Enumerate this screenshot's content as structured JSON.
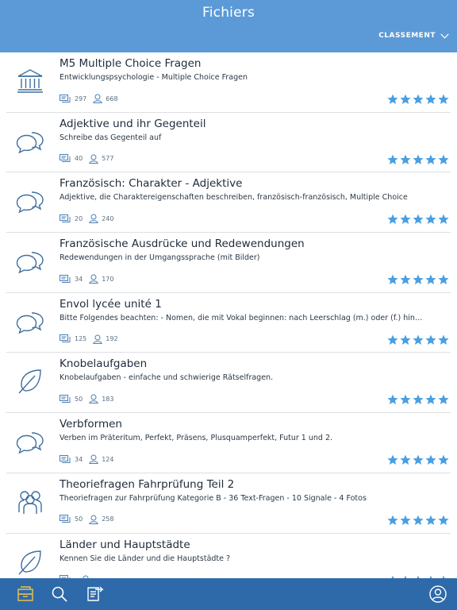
{
  "header": {
    "title": "Fichiers",
    "sort_label": "CLASSEMENT"
  },
  "colors": {
    "header": "#5b9ad6",
    "tabbar": "#2e6aa9",
    "star": "#4a9fe0",
    "tab_active": "#f2c44b"
  },
  "items": [
    {
      "title": "M5 Multiple Choice Fragen",
      "description": "Entwicklungspsychologie - Multiple Choice Fragen",
      "cards": "297",
      "users": "668",
      "icon": "institution-icon",
      "rating": 5
    },
    {
      "title": "Adjektive und ihr Gegenteil",
      "description": "Schreibe das Gegenteil auf",
      "cards": "40",
      "users": "577",
      "icon": "speech-bubbles-icon",
      "rating": 5
    },
    {
      "title": "Französisch: Charakter - Adjektive",
      "description": "Adjektive, die Charaktereigenschaften beschreiben, französisch-französisch, Multiple Choice",
      "cards": "20",
      "users": "240",
      "icon": "speech-bubbles-icon",
      "rating": 5
    },
    {
      "title": "Französische Ausdrücke und Redewendungen",
      "description": "Redewendungen in der Umgangssprache (mit Bilder)",
      "cards": "34",
      "users": "170",
      "icon": "speech-bubbles-icon",
      "rating": 5
    },
    {
      "title": "Envol lycée unité 1",
      "description": "Bitte Folgendes beachten: - Nomen, die mit Vokal beginnen: nach Leerschlag (m.) oder (f.) hinzu…",
      "cards": "125",
      "users": "192",
      "icon": "speech-bubbles-icon",
      "rating": 5
    },
    {
      "title": "Knobelaufgaben",
      "description": "Knobelaufgaben - einfache und schwierige Rätselfragen.",
      "cards": "50",
      "users": "183",
      "icon": "leaf-icon",
      "rating": 5
    },
    {
      "title": "Verbformen",
      "description": "Verben im Präteritum, Perfekt, Präsens, Plusquamperfekt, Futur 1 und 2.",
      "cards": "34",
      "users": "124",
      "icon": "speech-bubbles-icon",
      "rating": 5
    },
    {
      "title": "Theoriefragen Fahrprüfung Teil 2",
      "description": "Theoriefragen zur Fahrprüfung Kategorie B - 36 Text-Fragen - 10 Signale - 4 Fotos",
      "cards": "50",
      "users": "258",
      "icon": "people-group-icon",
      "rating": 5
    },
    {
      "title": "Länder und Hauptstädte",
      "description": "Kennen Sie die Länder und die Hauptstädte ?",
      "cards": "",
      "users": "",
      "icon": "leaf-icon",
      "rating": 5
    }
  ],
  "tabbar": {
    "tabs": [
      "library-tab",
      "search-tab",
      "import-tab",
      "profile-tab"
    ]
  }
}
